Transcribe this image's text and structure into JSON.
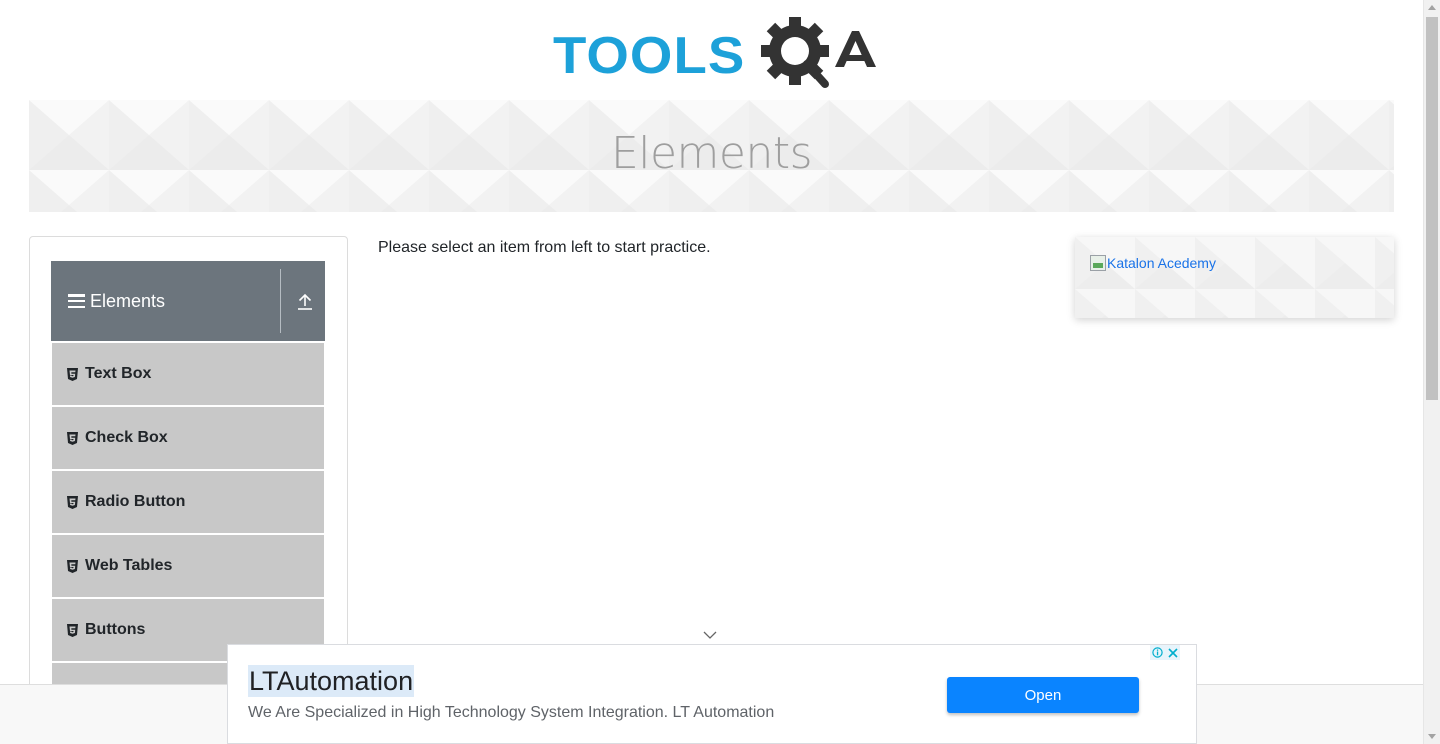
{
  "header": {
    "logo_text": "TOOLS",
    "logo_suffix": "QA"
  },
  "banner": {
    "title": "Elements"
  },
  "sidebar": {
    "group": {
      "label": "Elements",
      "menu_icon": "hamburger-icon",
      "collapse_icon": "upload-arrow-icon"
    },
    "item_icon": "html5-icon",
    "items": [
      {
        "label": "Text Box"
      },
      {
        "label": "Check Box"
      },
      {
        "label": "Radio Button"
      },
      {
        "label": "Web Tables"
      },
      {
        "label": "Buttons"
      }
    ]
  },
  "main": {
    "instruction": "Please select an item from left to start practice."
  },
  "side_ad": {
    "image_alt": "Katalon Acedemy"
  },
  "bottom_ad": {
    "title": "LTAutomation",
    "description": "We Are Specialized in High Technology System Integration. LT Automation",
    "button_label": "Open",
    "info_icon": "info-icon",
    "close_icon": "close-icon",
    "button_color": "#0a84ff"
  },
  "colors": {
    "logo_blue": "#1da1d9",
    "logo_dark": "#333333",
    "group_header_bg": "#6c757d",
    "menu_item_bg": "#c8c8c8"
  }
}
